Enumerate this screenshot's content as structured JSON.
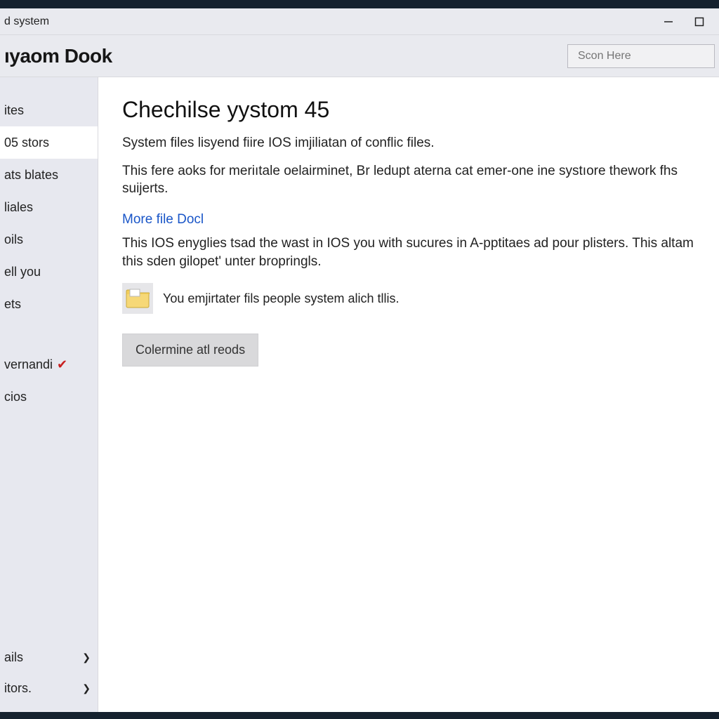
{
  "window": {
    "title": "d system"
  },
  "header": {
    "brand": "ıyaom Dook",
    "search": {
      "placeholder": "Scon Here"
    }
  },
  "sidebar": {
    "items": [
      {
        "label": "ites",
        "selected": false,
        "check": false
      },
      {
        "label": "05 stors",
        "selected": true,
        "check": false
      },
      {
        "label": "ats blates",
        "selected": false,
        "check": false
      },
      {
        "label": "liales",
        "selected": false,
        "check": false
      },
      {
        "label": "oils",
        "selected": false,
        "check": false
      },
      {
        "label": "ell you",
        "selected": false,
        "check": false
      },
      {
        "label": "ets",
        "selected": false,
        "check": false
      }
    ],
    "items2": [
      {
        "label": "vernandi",
        "selected": false,
        "check": true
      },
      {
        "label": "cios",
        "selected": false,
        "check": false
      }
    ],
    "bottom": [
      {
        "label": "ails"
      },
      {
        "label": "itors."
      }
    ]
  },
  "main": {
    "title": "Chechilse yystom 45",
    "p1": "System files lisyend fiire IOS imjiliatan of conflic files.",
    "p2": "This fere aoks for meriıtale oelairminet, Br ledupt aternа cat emer-one ine systıore thework fhs suijerts.",
    "link": "More file Docl",
    "p3": "This IOS enyglies tsad the wast in IOS you with sucures in A-pptitaes ad pour plisters.  This altam this sden gilopet' unter bropringls.",
    "note": "You emjirtater fils people system alich tllis.",
    "button": "Colermine atl reods"
  }
}
